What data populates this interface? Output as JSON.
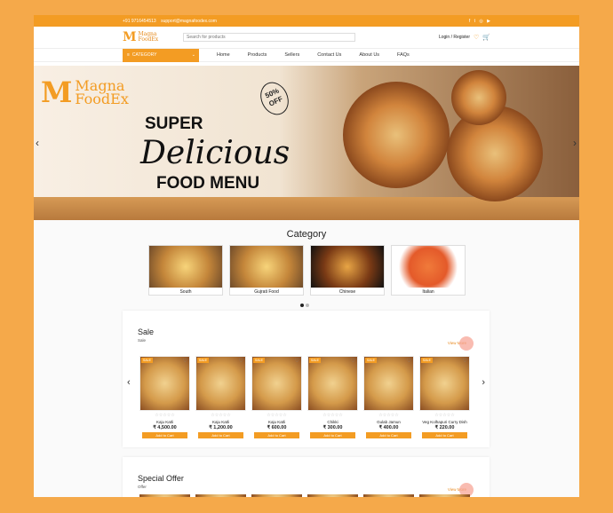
{
  "topbar": {
    "phone": "+91 9716454513",
    "email": "support@magnafoodex.com",
    "social_icons": [
      "facebook-icon",
      "twitter-icon",
      "instagram-icon",
      "youtube-icon"
    ]
  },
  "header": {
    "logo_brand": "Magna",
    "logo_sub": "FoodEx",
    "search_placeholder": "Search for products",
    "login_label": "Login / Register",
    "wishlist_icon": "heart-icon",
    "cart_icon": "cart-icon"
  },
  "nav": {
    "category_label": "CATEGORY",
    "links": [
      "Home",
      "Products",
      "Sellers",
      "Contact Us",
      "About Us",
      "FAQs"
    ]
  },
  "hero": {
    "brand": "Magna",
    "brand_sub": "FoodEx",
    "line1": "SUPER",
    "line2": "Delicious",
    "line3": "FOOD MENU",
    "badge": "50% OFF"
  },
  "categories": {
    "title": "Category",
    "items": [
      "South",
      "Gujrati Food",
      "Chinese",
      "Italian"
    ]
  },
  "sale": {
    "title": "Sale",
    "subtitle": "Sale",
    "view_all": "View More",
    "products": [
      {
        "tag": "SALE",
        "name": "Kaju Katli",
        "price": "₹ 4,500.00",
        "btn": "Add to Cart"
      },
      {
        "tag": "SALE",
        "name": "Kaju Katli",
        "price": "₹ 1,200.00",
        "btn": "Add to Cart"
      },
      {
        "tag": "SALE",
        "name": "Kaju Katli",
        "price": "₹ 600.00",
        "btn": "Add to Cart"
      },
      {
        "tag": "SALE",
        "name": "Chikki",
        "price": "₹ 300.00",
        "btn": "Add to Cart"
      },
      {
        "tag": "SALE",
        "name": "Gulab Jamun",
        "price": "₹ 400.00",
        "btn": "Add to Cart"
      },
      {
        "tag": "SALE",
        "name": "Veg Kolhapuri Curry Dish",
        "price": "₹ 220.00",
        "btn": "Add to Cart"
      }
    ]
  },
  "special": {
    "title": "Special Offer",
    "subtitle": "Offer",
    "view_all": "View More"
  },
  "colors": {
    "accent": "#f39c23",
    "background": "#f5a94a"
  }
}
